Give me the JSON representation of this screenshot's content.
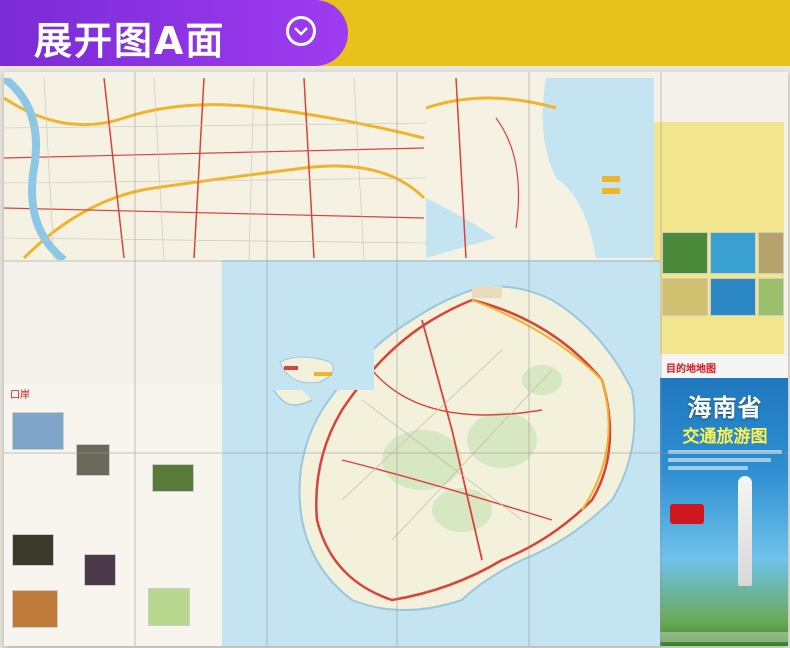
{
  "banner": {
    "title": "展开图A面",
    "icon": "chevron-down-circle-icon",
    "colors": {
      "tab": "#8a33e2",
      "bar": "#e6c21a"
    }
  },
  "map": {
    "inset_label": "口岸",
    "cover": {
      "brand": "目的地地图",
      "title": "海南省",
      "subtitle": "交通旅游图"
    },
    "colors": {
      "ocean": "#c4e4f1",
      "land": "#f3f0dc",
      "roads": "#d9433a",
      "highways": "#f0b42a",
      "cover_blue": "#1b72b8"
    }
  }
}
